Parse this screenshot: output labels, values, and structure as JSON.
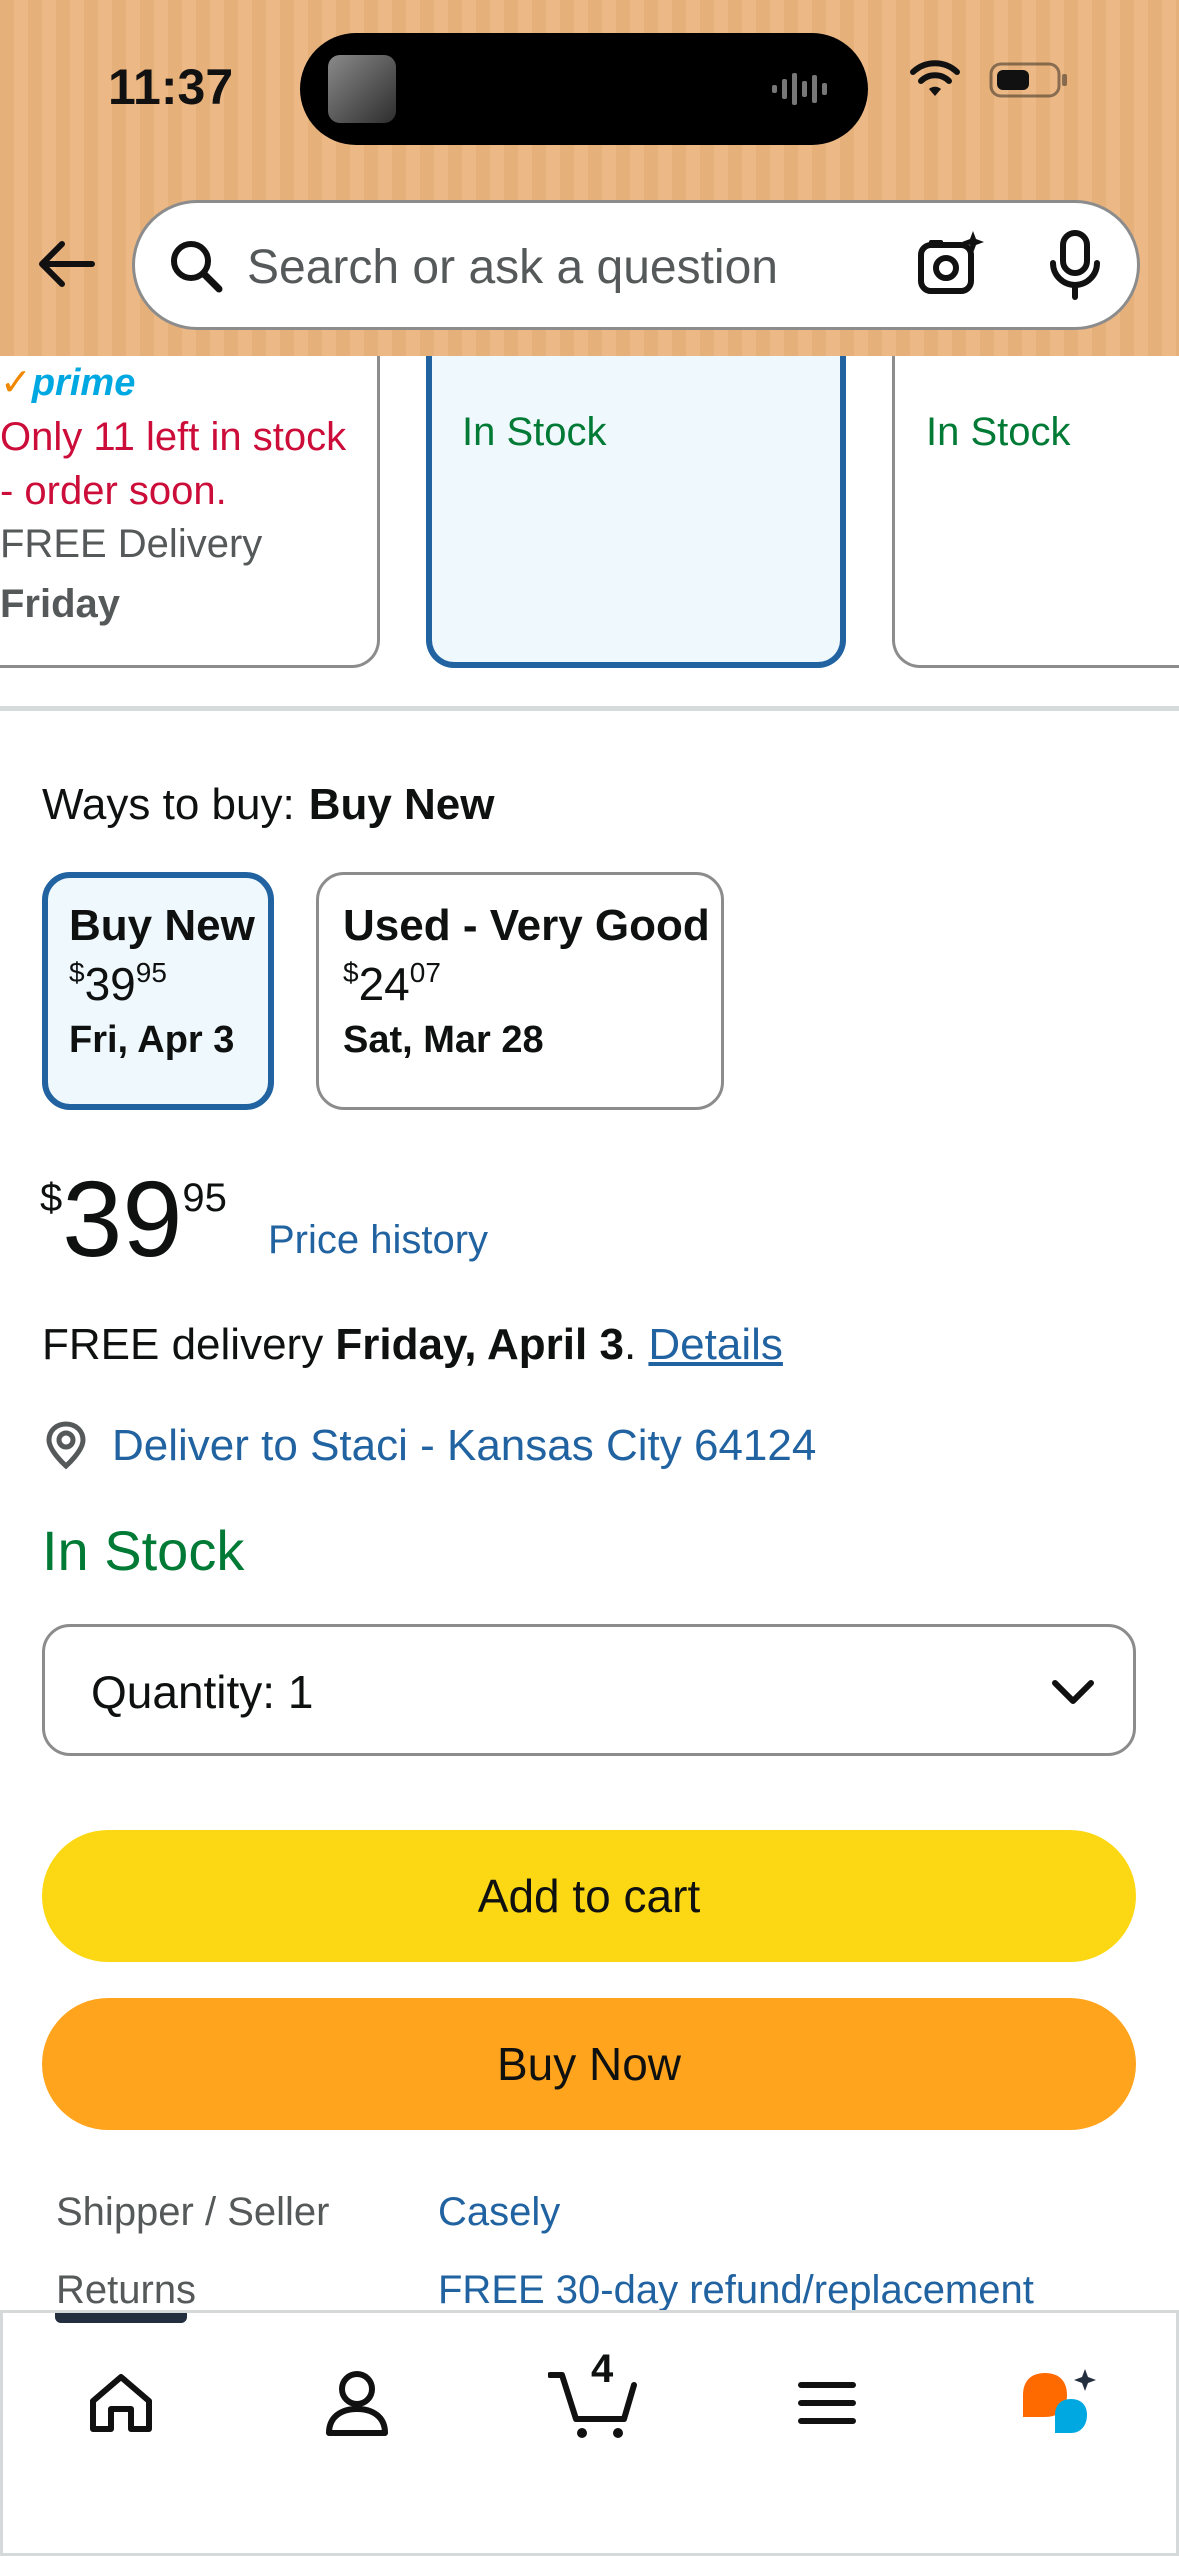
{
  "status_bar": {
    "time": "11:37"
  },
  "search": {
    "placeholder": "Search or ask a question"
  },
  "offer_cards": [
    {
      "prime": "prime",
      "stock": "Only 11 left in stock - order soon.",
      "delivery_label": "FREE Delivery",
      "delivery_day": "Friday"
    },
    {
      "stock": "In Stock"
    },
    {
      "stock": "In Stock"
    }
  ],
  "ways_to_buy": {
    "label": "Ways to buy:",
    "selected": "Buy New",
    "options": [
      {
        "title": "Buy New",
        "price_symbol": "$",
        "price_whole": "39",
        "price_fraction": "95",
        "date": "Fri, Apr 3"
      },
      {
        "title": "Used - Very Good",
        "price_symbol": "$",
        "price_whole": "24",
        "price_fraction": "07",
        "date": "Sat, Mar 28"
      }
    ]
  },
  "price": {
    "symbol": "$",
    "whole": "39",
    "fraction": "95",
    "history_link": "Price history"
  },
  "delivery": {
    "prefix": "FREE delivery",
    "date": "Friday, April 3",
    "suffix": ".",
    "details_link": "Details"
  },
  "deliver_to": "Deliver to Staci - Kansas City 64124",
  "stock_status": "In Stock",
  "quantity": {
    "label": "Quantity:",
    "value": "1"
  },
  "buttons": {
    "add_to_cart": "Add to cart",
    "buy_now": "Buy Now"
  },
  "info": [
    {
      "label": "Shipper / Seller",
      "value": "Casely"
    },
    {
      "label": "Returns",
      "value": "FREE 30-day refund/replacement"
    }
  ],
  "tabbar": {
    "cart_count": "4"
  },
  "colors": {
    "header": "#e6b07b",
    "link": "#2162a1",
    "in_stock": "#007a35",
    "low_stock": "#cc0c39",
    "add_to_cart": "#fcd814",
    "buy_now": "#ffa41c"
  }
}
